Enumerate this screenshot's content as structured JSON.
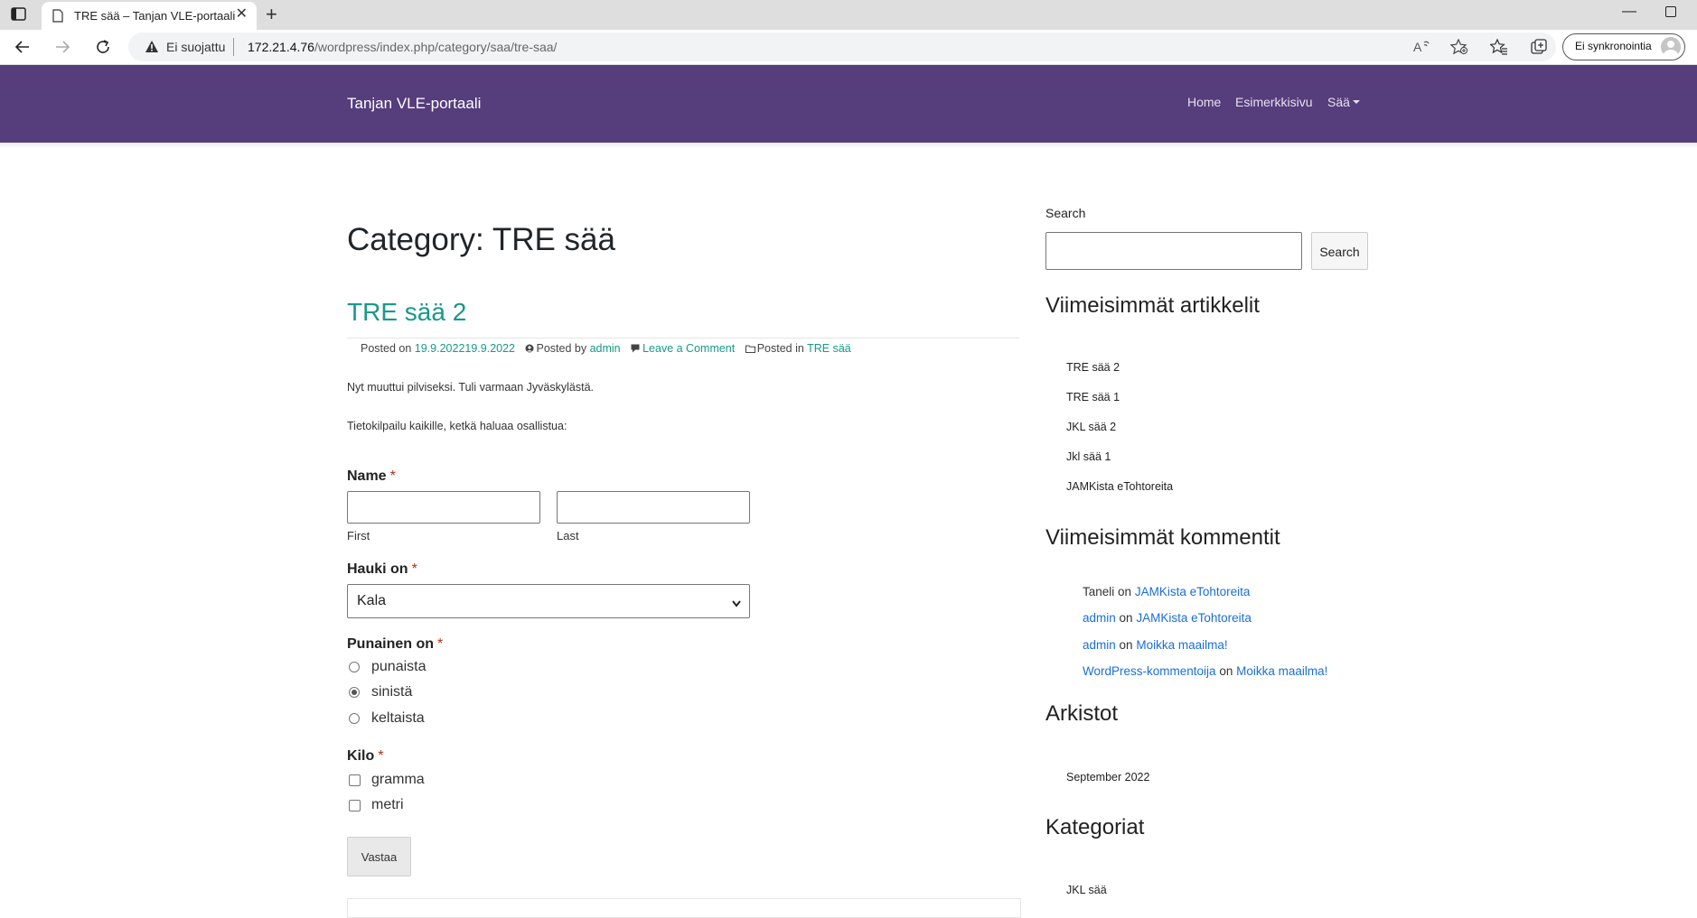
{
  "browser": {
    "tab_title": "TRE sää – Tanjan VLE-portaali",
    "new_tab_symbol": "+",
    "security_label": "Ei suojattu",
    "url_host": "172.21.4.76",
    "url_path": "/wordpress/index.php/category/saa/tre-saa/",
    "sync_label": "Ei synkronointia",
    "icons": [
      "tab-actions-icon",
      "page-icon",
      "close-icon",
      "back-icon",
      "forward-icon",
      "refresh-icon",
      "warning-icon",
      "read-aloud-icon",
      "favorite-add-icon",
      "favorites-icon",
      "collections-icon",
      "minimize-icon",
      "maximize-icon"
    ]
  },
  "site": {
    "brand": "Tanjan VLE-portaali",
    "nav": [
      "Home",
      "Esimerkkisivu",
      "Sää"
    ],
    "header_color": "#563d7c",
    "link_color": "#17998a"
  },
  "main": {
    "category_title": "Category: TRE sää",
    "post_title": "TRE sää 2",
    "meta": {
      "posted_on": "Posted on",
      "date": "19.9.202219.9.2022",
      "posted_by": "Posted by",
      "author": "admin",
      "comment_link": "Leave a Comment",
      "posted_in": "Posted in",
      "category": "TRE sää"
    },
    "paragraphs": [
      "Nyt muuttui pilviseksi. Tuli varmaan Jyväskylästä.",
      "Tietokilpailu kaikille, ketkä haluaa osallistua:"
    ]
  },
  "form": {
    "required_mark": "*",
    "name_label": "Name",
    "first_label": "First",
    "last_label": "Last",
    "hauki_label": "Hauki on",
    "hauki_selected": "Kala",
    "punainen_label": "Punainen on",
    "radio_options": [
      "punaista",
      "sinistä",
      "keltaista"
    ],
    "radio_selected": "sinistä",
    "kilo_label": "Kilo",
    "checkbox_options": [
      "gramma",
      "metri"
    ],
    "submit_label": "Vastaa"
  },
  "sidebar": {
    "search_label": "Search",
    "search_button": "Search",
    "recent_posts_heading": "Viimeisimmät artikkelit",
    "recent_posts": [
      "TRE sää 2",
      "TRE sää 1",
      "JKL sää 2",
      "Jkl sää 1",
      "JAMKista eTohtoreita"
    ],
    "recent_comments_heading": "Viimeisimmät kommentit",
    "recent_comments": [
      {
        "author": "Taneli",
        "on": "on",
        "post": "JAMKista eTohtoreita"
      },
      {
        "author": "admin",
        "on": "on",
        "post": "JAMKista eTohtoreita"
      },
      {
        "author": "admin",
        "on": "on",
        "post": "Moikka maailma!"
      },
      {
        "author": "WordPress-kommentoija",
        "on": "on",
        "post": "Moikka maailma!"
      }
    ],
    "archives_heading": "Arkistot",
    "archives": [
      "September 2022"
    ],
    "categories_heading": "Kategoriat",
    "categories": [
      "JKL sää"
    ]
  }
}
